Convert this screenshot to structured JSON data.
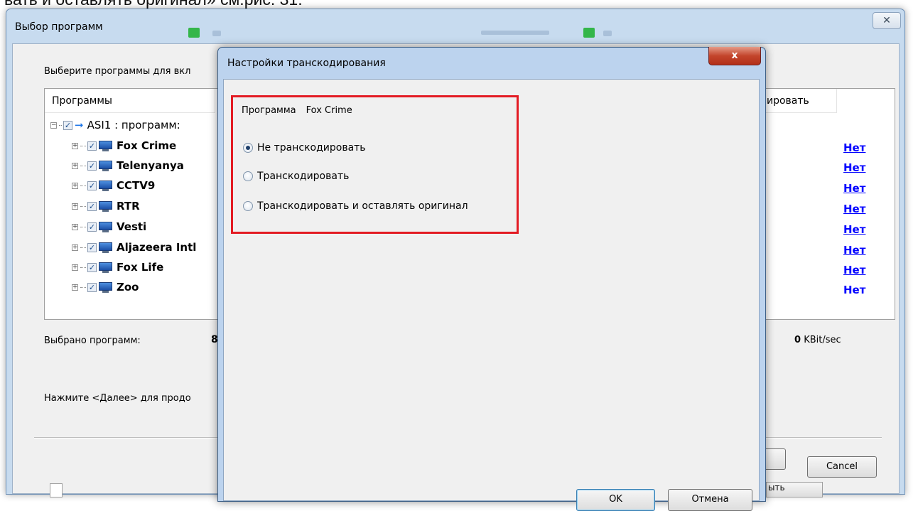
{
  "document": {
    "text_above": "вать и оставлять оригинал» см.рис. 31."
  },
  "back_window": {
    "title": "Выбор программ",
    "close_glyph": "✕",
    "instruction": "Выберите программы для вкл",
    "columns": {
      "programs": "Программы",
      "transcode": "ировать"
    },
    "root": {
      "label": "ASI1 : программ:",
      "icon": "arrow-right-icon",
      "expander": "−",
      "checked": "✓"
    },
    "programs": [
      {
        "name": "Fox Crime",
        "transcode": "Нет"
      },
      {
        "name": "Telenyanya",
        "transcode": "Нет"
      },
      {
        "name": "CCTV9",
        "transcode": "Нет"
      },
      {
        "name": "RTR",
        "transcode": "Нет"
      },
      {
        "name": "Vesti",
        "transcode": "Нет"
      },
      {
        "name": "Aljazeera Intl",
        "transcode": "Нет"
      },
      {
        "name": "Fox Life",
        "transcode": "Нет"
      },
      {
        "name": "Zoo",
        "transcode": "Нет"
      }
    ],
    "item_expander": "+",
    "item_checked": "✓",
    "summary": {
      "label": "Выбрано программ:",
      "count": "8",
      "rate_value": "0",
      "rate_unit": "KBit/sec"
    },
    "next_hint": "Нажмите <Далее> для продо",
    "cancel_label": "Cancel",
    "bottom_peek": "ыть"
  },
  "dialog": {
    "title": "Настройки транскодирования",
    "close_glyph": "x",
    "program_label": "Программа",
    "program_value": "Fox Crime",
    "options": [
      {
        "label": "Не транскодировать",
        "selected": true
      },
      {
        "label": "Транскодировать",
        "selected": false
      },
      {
        "label": "Транскодировать и оставлять оригинал",
        "selected": false
      }
    ],
    "ok_label": "OK",
    "cancel_label": "Отмена"
  },
  "colors": {
    "highlight_frame": "#e31b23",
    "link": "#0000ff",
    "titlebar": "#bcd3ee"
  }
}
